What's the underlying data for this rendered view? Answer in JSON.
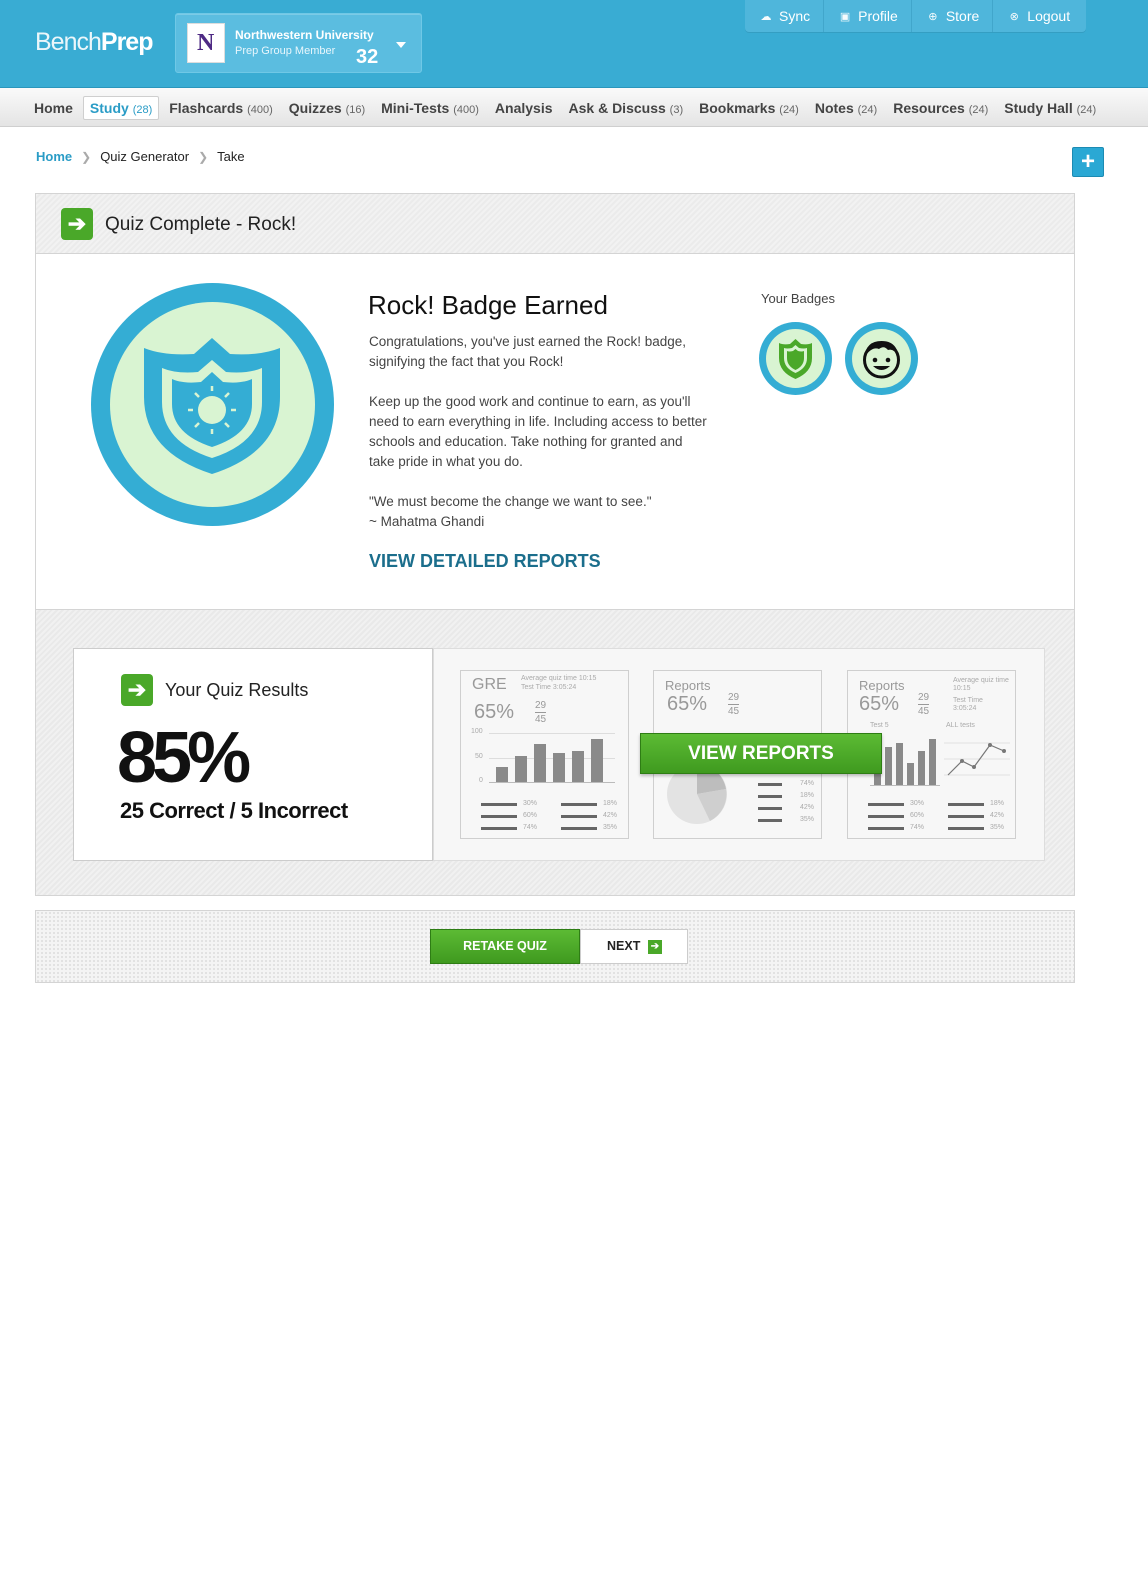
{
  "header": {
    "logo_part1": "Bench",
    "logo_part2": "Prep",
    "school": {
      "name": "Northwestern University",
      "role": "Prep Group Member",
      "count": "32",
      "logo_letter": "N"
    },
    "topnav": [
      {
        "label": "Sync",
        "icon": "cloud-icon"
      },
      {
        "label": "Profile",
        "icon": "profile-icon"
      },
      {
        "label": "Store",
        "icon": "download-icon"
      },
      {
        "label": "Logout",
        "icon": "close-circle-icon"
      }
    ]
  },
  "nav": {
    "items": [
      {
        "label": "Home",
        "count": ""
      },
      {
        "label": "Study",
        "count": "(28)",
        "active": true
      },
      {
        "label": "Flashcards",
        "count": "(400)"
      },
      {
        "label": "Quizzes",
        "count": "(16)"
      },
      {
        "label": "Mini-Tests",
        "count": "(400)"
      },
      {
        "label": "Analysis",
        "count": ""
      },
      {
        "label": "Ask & Discuss",
        "count": "(3)"
      },
      {
        "label": "Bookmarks",
        "count": "(24)"
      },
      {
        "label": "Notes",
        "count": "(24)"
      },
      {
        "label": "Resources",
        "count": "(24)"
      },
      {
        "label": "Study Hall",
        "count": "(24)"
      }
    ]
  },
  "breadcrumb": {
    "home": "Home",
    "item1": "Quiz Generator",
    "item2": "Take",
    "sep": "❯"
  },
  "add_button": "+",
  "panel": {
    "title": "Quiz Complete - Rock!",
    "badge_title": "Rock! Badge Earned",
    "para1": "Congratulations, you've just earned the Rock! badge, signifying the fact that you Rock!",
    "para2": "Keep up the good work and continue to earn, as you'll need to earn everything in life. Including access to better schools and education. Take nothing for granted and take pride in what you do.",
    "quote": "\"We must become the change we want to see.\"",
    "quote_author": "~ Mahatma Ghandi",
    "link": "VIEW DETAILED REPORTS",
    "your_badges": "Your Badges"
  },
  "results": {
    "title": "Your Quiz Results",
    "percent": "85%",
    "summary": "25 Correct / 5 Incorrect",
    "view_reports": "VIEW REPORTS",
    "cards": [
      {
        "title": "GRE",
        "pct": "65%",
        "num": "29",
        "den": "45",
        "meta1": "Average quiz time 10:15",
        "meta2": "Test Time 3:05:24",
        "y100": "100",
        "y50": "50",
        "y0": "0",
        "stat1": "30%",
        "stat2": "60%",
        "stat3": "74%",
        "stat4": "18%",
        "stat5": "42%",
        "stat6": "35%"
      },
      {
        "title": "Reports",
        "pct": "65%",
        "num": "29",
        "den": "45",
        "stat1": "74%",
        "stat2": "18%",
        "stat3": "42%",
        "stat4": "35%"
      },
      {
        "title": "Reports",
        "pct": "65%",
        "num": "29",
        "den": "45",
        "meta1": "Average quiz time 10:15",
        "meta2": "Test Time 3:05:24",
        "sub1": "Test 5",
        "sub2": "ALL tests",
        "stat1": "30%",
        "stat2": "60%",
        "stat3": "74%",
        "stat4": "18%",
        "stat5": "42%",
        "stat6": "35%"
      }
    ]
  },
  "actions": {
    "retake": "RETAKE QUIZ",
    "next": "NEXT"
  },
  "colors": {
    "brand": "#39acd3",
    "green": "#4aa829",
    "link": "#1b6e8c",
    "badge_bg": "#d9f4d2"
  }
}
